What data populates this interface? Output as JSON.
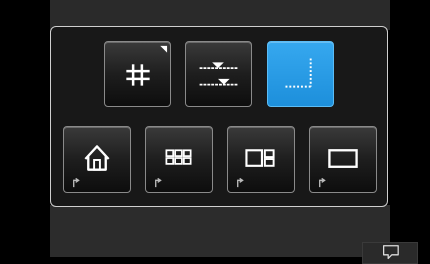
{
  "colors": {
    "accent": "#1d8fdb",
    "panel": "#181818",
    "border": "#cfcfcf",
    "background": "#000000"
  },
  "popup": {
    "row1": [
      {
        "id": "grid",
        "icon": "grid-hash-icon",
        "active": false,
        "has_corner_indicator": true
      },
      {
        "id": "level",
        "icon": "level-indicator-icon",
        "active": false,
        "has_corner_indicator": false
      },
      {
        "id": "focus-corner",
        "icon": "dotted-corner-icon",
        "active": true,
        "has_corner_indicator": false
      }
    ],
    "row2": [
      {
        "id": "home",
        "icon": "home-icon",
        "has_return_indicator": true
      },
      {
        "id": "grid-view",
        "icon": "thumbnail-grid-icon",
        "has_return_indicator": true
      },
      {
        "id": "split-view",
        "icon": "split-view-icon",
        "has_return_indicator": true
      },
      {
        "id": "single-view",
        "icon": "single-frame-icon",
        "has_return_indicator": true
      }
    ]
  },
  "chat_button": {
    "icon": "speech-bubble-icon"
  }
}
